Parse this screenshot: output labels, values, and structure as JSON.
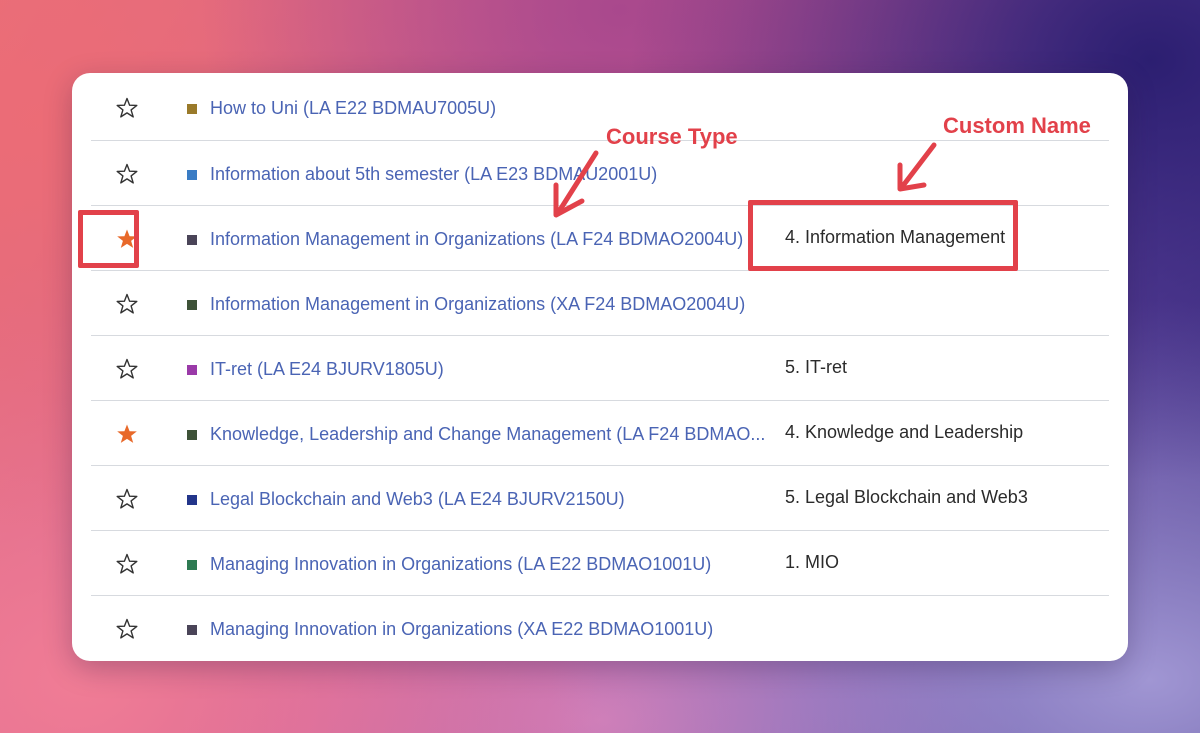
{
  "courses": [
    {
      "starred": false,
      "color": "#9a7a2a",
      "name": "How to Uni (LA E22 BDMAU7005U)",
      "custom_name": ""
    },
    {
      "starred": false,
      "color": "#3a7cc4",
      "name": "Information about 5th semester (LA E23 BDMAU2001U)",
      "custom_name": ""
    },
    {
      "starred": true,
      "color": "#4a4458",
      "name": "Information Management in Organizations (LA F24 BDMAO2004U)",
      "custom_name": "4. Information Management"
    },
    {
      "starred": false,
      "color": "#3e5238",
      "name": "Information Management in Organizations (XA F24 BDMAO2004U)",
      "custom_name": ""
    },
    {
      "starred": false,
      "color": "#9a3aa8",
      "name": "IT-ret (LA E24 BJURV1805U)",
      "custom_name": "5. IT-ret"
    },
    {
      "starred": true,
      "color": "#3e5238",
      "name": "Knowledge, Leadership and Change Management (LA F24 BDMAO...",
      "custom_name": "4. Knowledge and Leadership"
    },
    {
      "starred": false,
      "color": "#23358a",
      "name": "Legal Blockchain and Web3 (LA E24 BJURV2150U)",
      "custom_name": "5. Legal Blockchain and Web3"
    },
    {
      "starred": false,
      "color": "#2e7a52",
      "name": "Managing Innovation in Organizations (LA E22 BDMAO1001U)",
      "custom_name": "1. MIO"
    },
    {
      "starred": false,
      "color": "#4a4458",
      "name": "Managing Innovation in Organizations (XA E22 BDMAO1001U)",
      "custom_name": ""
    }
  ],
  "annotations": {
    "course_type_label": "Course Type",
    "custom_name_label": "Custom Name",
    "color": "#e2414a"
  },
  "colors": {
    "star_filled": "#e8692a",
    "star_outline": "#333333",
    "link": "#4a64b4"
  },
  "icons": {
    "star_filled": "star-filled-icon",
    "star_outline": "star-outline-icon",
    "annotation_arrow": "arrow-icon"
  }
}
